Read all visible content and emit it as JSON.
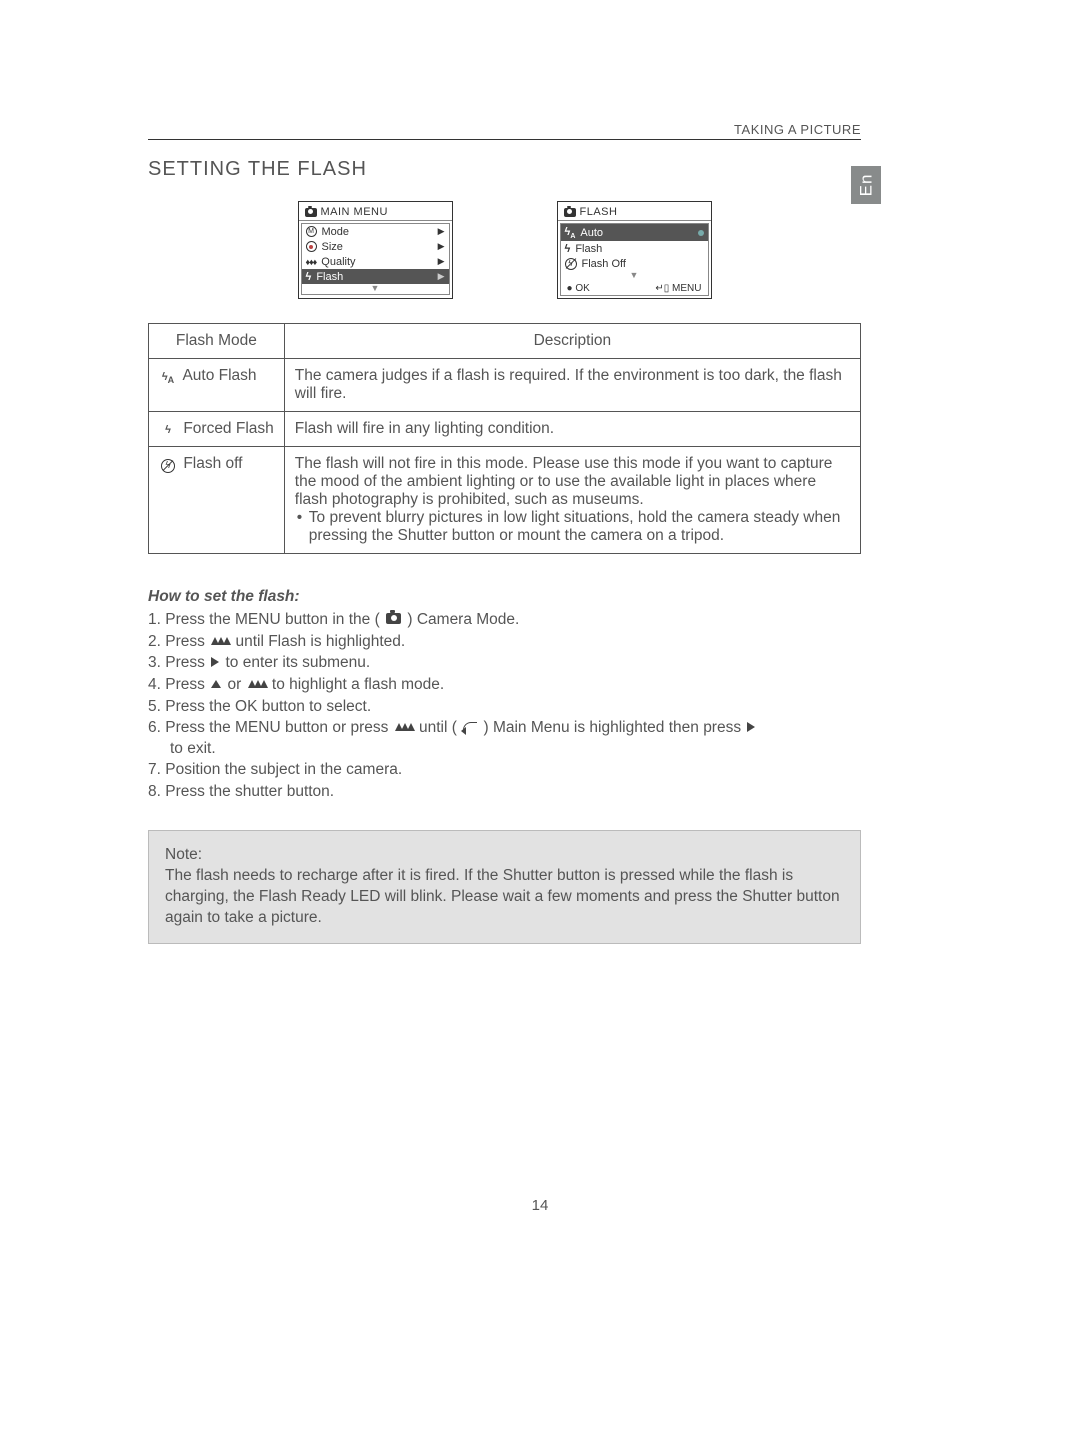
{
  "header": {
    "chapter": "TAKING A PICTURE"
  },
  "section_title": "SETTING THE FLASH",
  "lang_tab": "En",
  "menu_main": {
    "title": "MAIN MENU",
    "items": [
      {
        "icon": "mode-circle",
        "label": "Mode"
      },
      {
        "icon": "target",
        "label": "Size"
      },
      {
        "icon": "diamonds",
        "label": "Quality"
      },
      {
        "icon": "bolt",
        "label": "Flash",
        "selected": true
      }
    ]
  },
  "menu_flash": {
    "title": "FLASH",
    "items": [
      {
        "icon": "bolt-a",
        "label": "Auto",
        "selected": true,
        "dot": true
      },
      {
        "icon": "bolt",
        "label": "Flash"
      },
      {
        "icon": "noflash",
        "label": "Flash Off"
      }
    ],
    "footer_left": "OK",
    "footer_right": "MENU"
  },
  "table": {
    "headers": [
      "Flash Mode",
      "Description"
    ],
    "rows": [
      {
        "mode_icon": "bolt-a",
        "mode": "Auto Flash",
        "desc": "The camera judges if a flash is required. If the environment is too dark, the flash will fire."
      },
      {
        "mode_icon": "bolt",
        "mode": "Forced Flash",
        "desc": "Flash will fire in any lighting condition."
      },
      {
        "mode_icon": "noflash",
        "mode": "Flash off",
        "desc": "The flash will not fire in this mode. Please use this mode if you want to capture the mood of the ambient lighting or to use the available light in places where flash photography is prohibited, such as museums.",
        "bullet": "To prevent blurry pictures in low light situations, hold the camera steady when pressing the Shutter button or mount the camera on a tripod."
      }
    ]
  },
  "howto_title": "How to set the flash:",
  "steps": {
    "s1a": "1.  Press the MENU button in the ( ",
    "s1b": " ) Camera Mode.",
    "s2a": "2.  Press ",
    "s2b": " until Flash is highlighted.",
    "s3a": "3.  Press  ",
    "s3b": "  to enter its submenu.",
    "s4a": "4.  Press  ",
    "s4b": "   or ",
    "s4c": "  to highlight a flash mode.",
    "s5": "5.  Press the OK button to select.",
    "s6a": "6.  Press the MENU button or press  ",
    "s6b": "  until ( ",
    "s6c": " ) Main Menu is highlighted then press  ",
    "s6d": "  to exit.",
    "s7": "7.  Position the subject in the camera.",
    "s8": "8.  Press the shutter  button."
  },
  "note_label": "Note:",
  "note_body": "The flash needs to recharge after it is fired.  If the Shutter button is pressed while the flash is charging, the Flash Ready LED will blink. Please wait a few moments and press the Shutter button again to take a picture.",
  "page_number": "14"
}
